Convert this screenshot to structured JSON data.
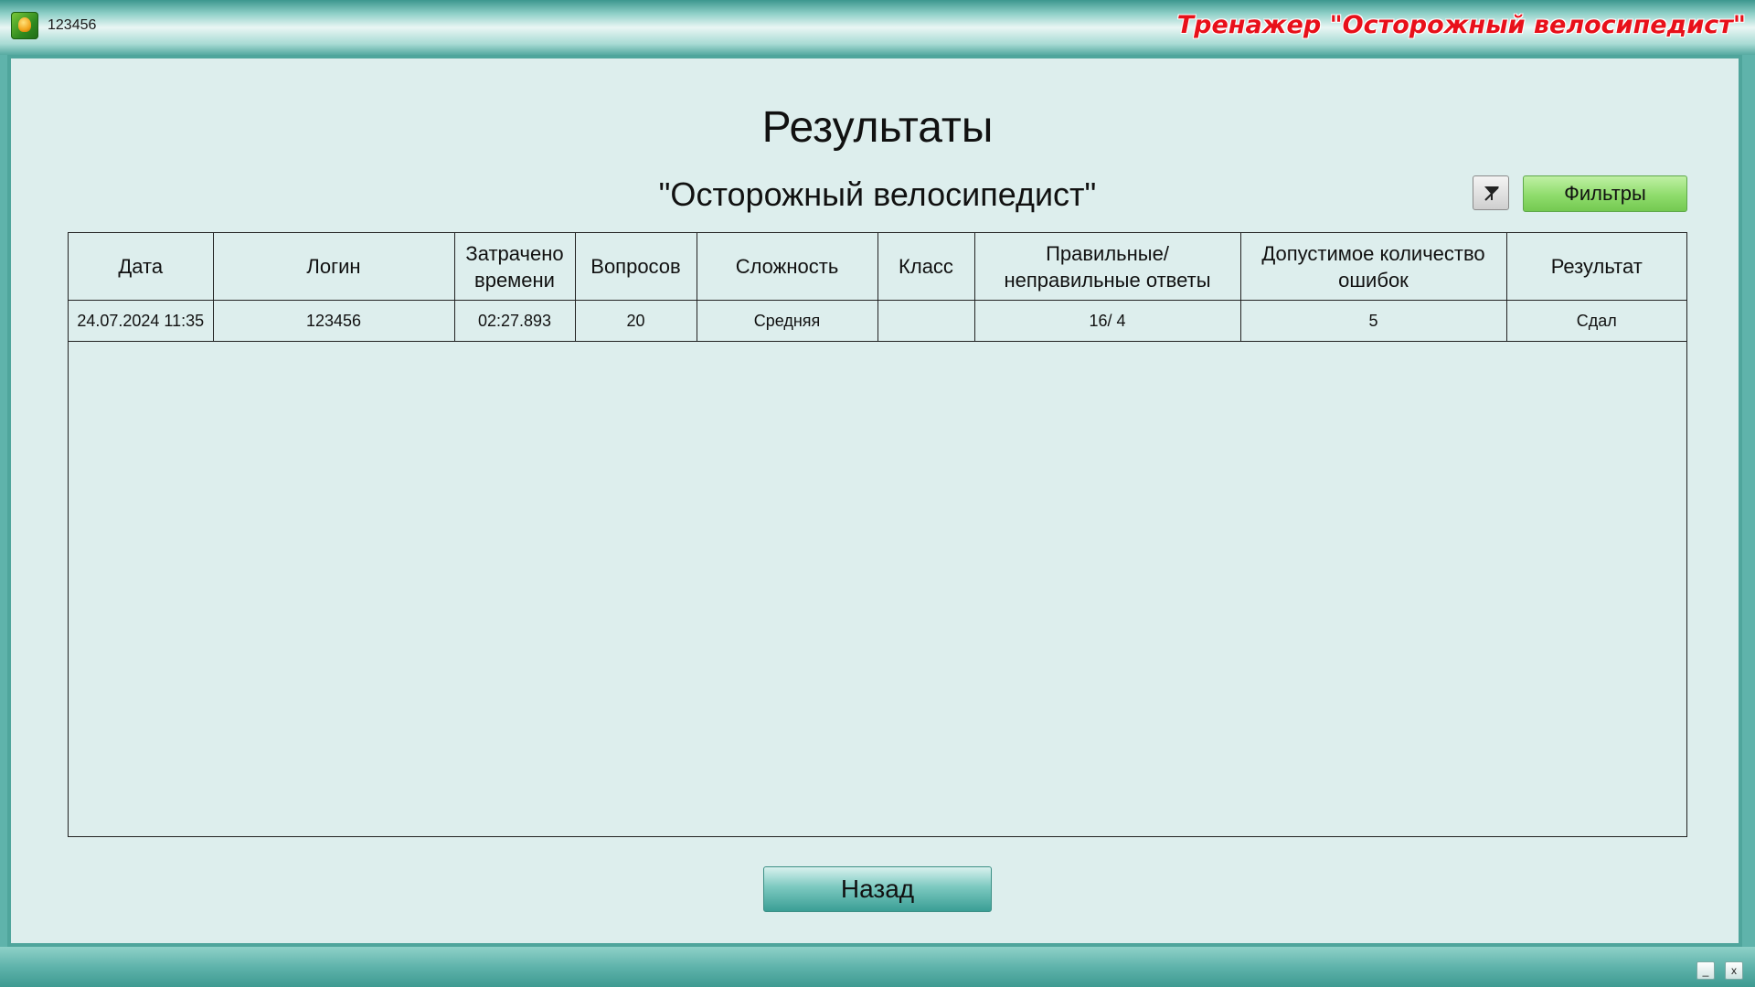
{
  "header": {
    "username": "123456",
    "app_title": "Тренажер \"Осторожный велосипедист\""
  },
  "page": {
    "title": "Результаты",
    "subtitle": "\"Осторожный велосипедист\"",
    "filters_label": "Фильтры",
    "back_label": "Назад"
  },
  "table": {
    "columns": [
      "Дата",
      "Логин",
      "Затрачено времени",
      "Вопросов",
      "Сложность",
      "Класс",
      "Правильные/ неправильные ответы",
      "Допустимое количество ошибок",
      "Результат"
    ],
    "rows": [
      [
        "24.07.2024 11:35",
        "123456",
        "02:27.893",
        "20",
        "Средняя",
        "",
        "16/ 4",
        "5",
        "Сдал"
      ]
    ]
  },
  "window_controls": {
    "minimize": "_",
    "close": "x"
  },
  "icons": {
    "app": "app-logo-icon",
    "clear_filter": "clear-filter-icon"
  },
  "colors": {
    "title_red": "#e8101a",
    "filters_green": "#8fdc6c",
    "panel_bg": "#ddeeed",
    "frame_teal": "#4fa59c"
  }
}
